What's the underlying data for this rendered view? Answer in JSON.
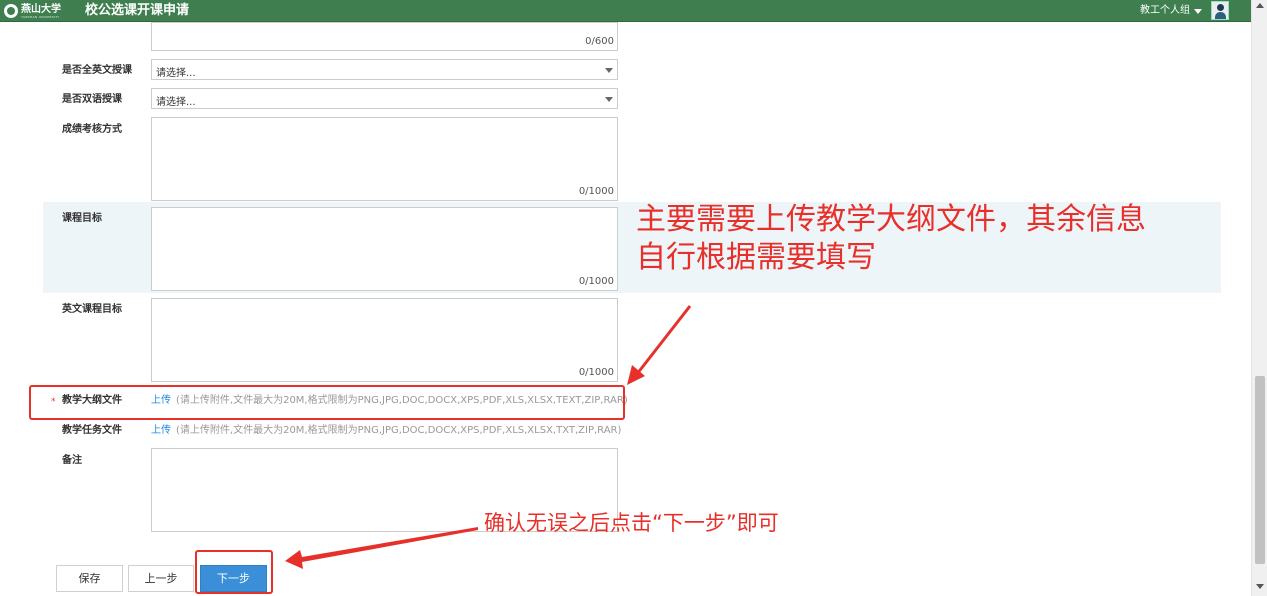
{
  "header": {
    "logo_name": "燕山大学",
    "logo_sub": "YANSHAN UNIVERSITY",
    "title": "校公选课开课申请",
    "role": "教工个人组"
  },
  "form": {
    "top_counter": "0/600",
    "all_english": {
      "label": "是否全英文授课",
      "placeholder": "请选择..."
    },
    "bilingual": {
      "label": "是否双语授课",
      "placeholder": "请选择..."
    },
    "assessment": {
      "label": "成绩考核方式",
      "counter": "0/1000"
    },
    "course_goal": {
      "label": "课程目标",
      "counter": "0/1000"
    },
    "english_goal": {
      "label": "英文课程目标",
      "counter": "0/1000"
    },
    "syllabus": {
      "required_mark": "*",
      "label": "教学大纲文件",
      "upload": "上传",
      "hint": "(请上传附件,文件最大为20M,格式限制为PNG,JPG,DOC,DOCX,XPS,PDF,XLS,XLSX,TEXT,ZIP,RAR)"
    },
    "task_file": {
      "label": "教学任务文件",
      "upload": "上传",
      "hint": "(请上传附件,文件最大为20M,格式限制为PNG,JPG,DOC,DOCX,XPS,PDF,XLS,XLSX,TXT,ZIP,RAR)"
    },
    "remarks": {
      "label": "备注"
    }
  },
  "buttons": {
    "save": "保存",
    "prev": "上一步",
    "next": "下一步"
  },
  "annotations": {
    "note1_line1": "主要需要上传教学大纲文件，其余信息",
    "note1_line2": "自行根据需要填写",
    "note2": "确认无误之后点击“下一步”即可",
    "color": "#e8302b"
  },
  "colors": {
    "header": "#3f7f4f",
    "primary_button": "#3a8fd8",
    "link": "#1e88e5"
  }
}
